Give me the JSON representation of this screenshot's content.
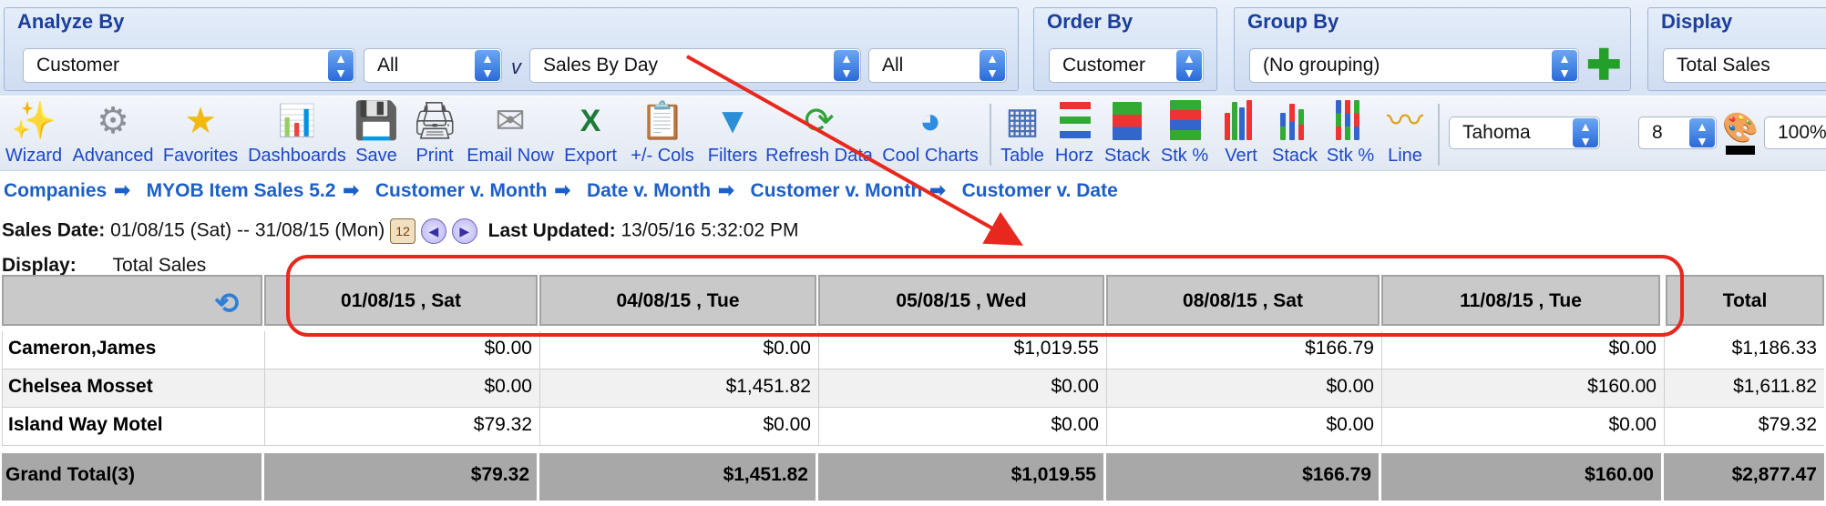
{
  "filters": {
    "analyze_by": {
      "title": "Analyze By",
      "primary": "Customer",
      "primary_filter": "All",
      "versus": "v",
      "secondary": "Sales By Day",
      "secondary_filter": "All"
    },
    "order_by": {
      "title": "Order By",
      "value": "Customer"
    },
    "group_by": {
      "title": "Group By",
      "value": "(No grouping)"
    },
    "display": {
      "title": "Display",
      "value": "Total Sales"
    }
  },
  "toolbar": {
    "wizard": "Wizard",
    "advanced": "Advanced",
    "favorites": "Favorites",
    "dashboards": "Dashboards",
    "save": "Save",
    "print": "Print",
    "email_now": "Email Now",
    "export": "Export",
    "cols": "+/- Cols",
    "filters": "Filters",
    "refresh_data": "Refresh Data",
    "cool_charts": "Cool Charts",
    "table": "Table",
    "horz": "Horz",
    "stack": "Stack",
    "stk_pct": "Stk %",
    "vert": "Vert",
    "stack2": "Stack",
    "stk_pct2": "Stk %",
    "line": "Line",
    "font": "Tahoma",
    "font_size": "8",
    "zoom": "100%"
  },
  "breadcrumbs": [
    "Companies",
    "MYOB Item Sales 5.2",
    "Customer v. Month",
    "Date v. Month",
    "Customer v. Month",
    "Customer v. Date"
  ],
  "info": {
    "sales_date_label": "Sales Date:",
    "sales_date_value": "01/08/15 (Sat) -- 31/08/15 (Mon)",
    "last_updated_label": "Last Updated:",
    "last_updated_value": "13/05/16 5:32:02 PM",
    "display_label": "Display:",
    "display_value": "Total Sales"
  },
  "table": {
    "columns": [
      "01/08/15 , Sat",
      "04/08/15 , Tue",
      "05/08/15 , Wed",
      "08/08/15 , Sat",
      "11/08/15 , Tue",
      "Total"
    ],
    "rows": [
      {
        "name": "Cameron,James",
        "values": [
          "$0.00",
          "$0.00",
          "$1,019.55",
          "$166.79",
          "$0.00",
          "$1,186.33"
        ]
      },
      {
        "name": "Chelsea Mosset",
        "values": [
          "$0.00",
          "$1,451.82",
          "$0.00",
          "$0.00",
          "$160.00",
          "$1,611.82"
        ]
      },
      {
        "name": "Island Way Motel",
        "values": [
          "$79.32",
          "$0.00",
          "$0.00",
          "$0.00",
          "$0.00",
          "$79.32"
        ]
      }
    ],
    "grand_total": {
      "name": "Grand Total(3)",
      "values": [
        "$79.32",
        "$1,451.82",
        "$1,019.55",
        "$166.79",
        "$160.00",
        "$2,877.47"
      ]
    }
  },
  "colors": {
    "annotation": "#e8271e",
    "link": "#1b5fc8",
    "header_bg": "#c9c9c9"
  }
}
